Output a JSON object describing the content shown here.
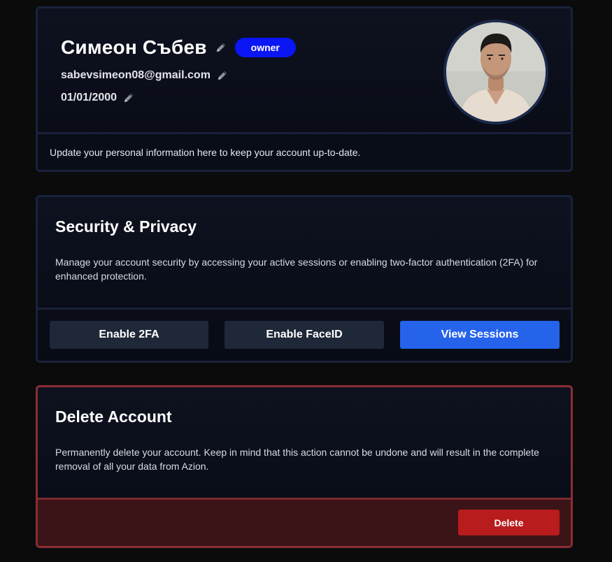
{
  "profile": {
    "name": "Симеон Събев",
    "role_badge": "owner",
    "email": "sabevsimeon08@gmail.com",
    "birth_date": "01/01/2000",
    "footer_text": "Update your personal information here to keep your account up-to-date."
  },
  "security": {
    "title": "Security & Privacy",
    "description": "Manage your account security by accessing your active sessions or enabling two-factor authentication (2FA) for enhanced protection.",
    "enable_2fa_label": "Enable 2FA",
    "enable_faceid_label": "Enable FaceID",
    "view_sessions_label": "View Sessions"
  },
  "delete_account": {
    "title": "Delete Account",
    "description": "Permanently delete your account. Keep in mind that this action cannot be undone and will result in the complete removal of all your data from Azion.",
    "delete_label": "Delete"
  },
  "colors": {
    "background": "#0b0b0c",
    "card_border": "#19223a",
    "badge": "#0b16f5",
    "primary_button": "#2563eb",
    "secondary_button": "#1f2838",
    "danger_border": "#8b2d33",
    "danger_footer": "#3b1418",
    "danger_button": "#b91c1c"
  },
  "icons": {
    "edit": "pencil-icon",
    "avatar": "profile-photo"
  }
}
